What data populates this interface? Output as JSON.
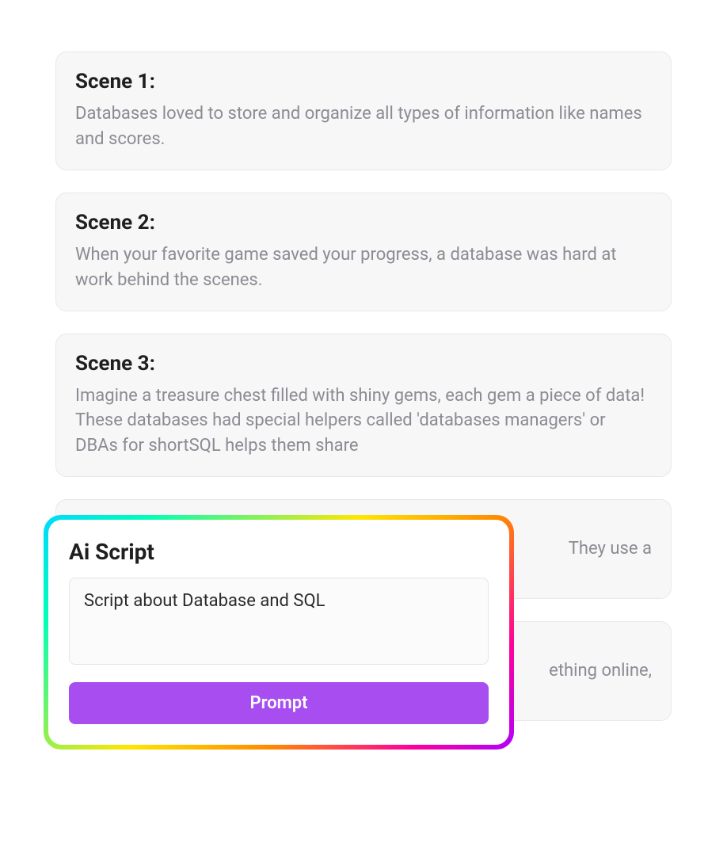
{
  "scenes": [
    {
      "title": "Scene 1:",
      "body": "Databases loved to store and organize all types of information like names and scores."
    },
    {
      "title": "Scene 2:",
      "body": "When your favorite game saved your progress, a database was hard at work behind the scenes."
    },
    {
      "title": "Scene 3:",
      "body": "Imagine a treasure chest filled with shiny gems, each gem a piece of data! These databases had special helpers called 'databases managers' or DBAs for shortSQL helps them share"
    },
    {
      "title": "",
      "body": "They use a"
    },
    {
      "title": "",
      "body": "ething online,"
    }
  ],
  "aiScript": {
    "title": "Ai Script",
    "inputValue": "Script about Database and SQL",
    "buttonLabel": "Prompt"
  }
}
